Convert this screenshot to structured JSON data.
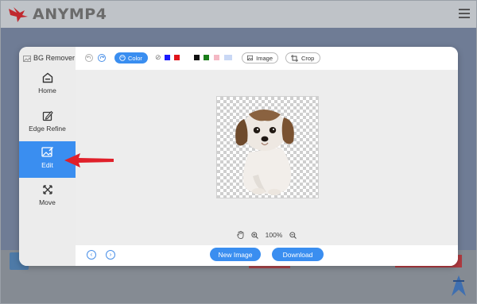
{
  "site": {
    "logo_text": "ANYMP4",
    "brand_color": "#c0282e"
  },
  "app": {
    "title": "BG Remover",
    "sidebar": [
      {
        "label": "Home",
        "icon": "home-icon"
      },
      {
        "label": "Edge Refine",
        "icon": "edge-refine-icon"
      },
      {
        "label": "Edit",
        "icon": "edit-image-icon",
        "active": true
      },
      {
        "label": "Move",
        "icon": "move-icon"
      }
    ],
    "toolbar": {
      "color_label": "Color",
      "image_label": "Image",
      "crop_label": "Crop",
      "swatches": [
        "#1a1aff",
        "#e0141b",
        "#ffffff",
        "#111111",
        "#1a7d1a",
        "#f4b8c4",
        "#c9d8f5"
      ]
    },
    "zoom_level": "100%",
    "new_image_label": "New Image",
    "download_label": "Download",
    "accent_color": "#3a8ef0"
  }
}
